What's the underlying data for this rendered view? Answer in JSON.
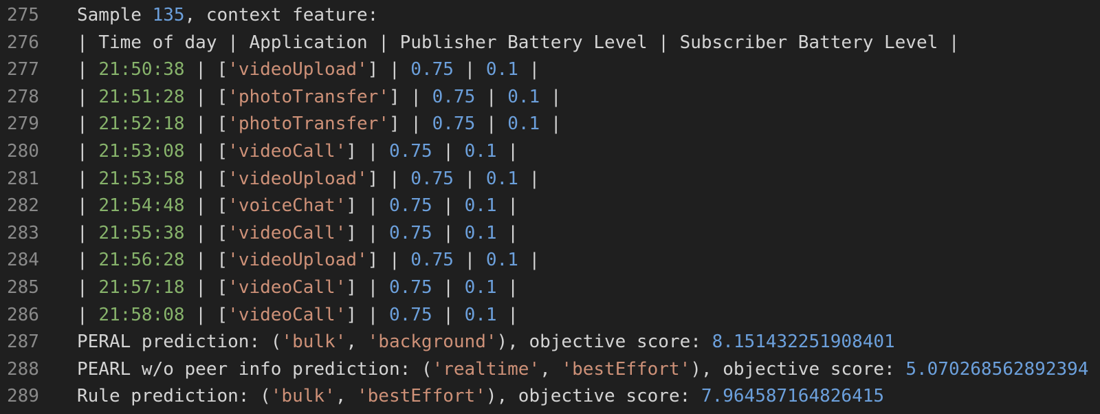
{
  "lines": [
    {
      "num": "275",
      "tokens": [
        {
          "c": "p",
          "t": "Sample "
        },
        {
          "c": "n",
          "t": "135"
        },
        {
          "c": "p",
          "t": ", context feature:"
        }
      ]
    },
    {
      "num": "276",
      "tokens": [
        {
          "c": "p",
          "t": "| Time of day | Application | Publisher Battery Level | Subscriber Battery Level |"
        }
      ]
    },
    {
      "num": "277",
      "tokens": [
        {
          "c": "p",
          "t": "| "
        },
        {
          "c": "t",
          "t": "21:50:38"
        },
        {
          "c": "p",
          "t": " | ["
        },
        {
          "c": "s",
          "t": "'videoUpload'"
        },
        {
          "c": "p",
          "t": "] | "
        },
        {
          "c": "n",
          "t": "0.75"
        },
        {
          "c": "p",
          "t": " | "
        },
        {
          "c": "n",
          "t": "0.1"
        },
        {
          "c": "p",
          "t": " |"
        }
      ]
    },
    {
      "num": "278",
      "tokens": [
        {
          "c": "p",
          "t": "| "
        },
        {
          "c": "t",
          "t": "21:51:28"
        },
        {
          "c": "p",
          "t": " | ["
        },
        {
          "c": "s",
          "t": "'photoTransfer'"
        },
        {
          "c": "p",
          "t": "] | "
        },
        {
          "c": "n",
          "t": "0.75"
        },
        {
          "c": "p",
          "t": " | "
        },
        {
          "c": "n",
          "t": "0.1"
        },
        {
          "c": "p",
          "t": " |"
        }
      ]
    },
    {
      "num": "279",
      "tokens": [
        {
          "c": "p",
          "t": "| "
        },
        {
          "c": "t",
          "t": "21:52:18"
        },
        {
          "c": "p",
          "t": " | ["
        },
        {
          "c": "s",
          "t": "'photoTransfer'"
        },
        {
          "c": "p",
          "t": "] | "
        },
        {
          "c": "n",
          "t": "0.75"
        },
        {
          "c": "p",
          "t": " | "
        },
        {
          "c": "n",
          "t": "0.1"
        },
        {
          "c": "p",
          "t": " |"
        }
      ]
    },
    {
      "num": "280",
      "tokens": [
        {
          "c": "p",
          "t": "| "
        },
        {
          "c": "t",
          "t": "21:53:08"
        },
        {
          "c": "p",
          "t": " | ["
        },
        {
          "c": "s",
          "t": "'videoCall'"
        },
        {
          "c": "p",
          "t": "] | "
        },
        {
          "c": "n",
          "t": "0.75"
        },
        {
          "c": "p",
          "t": " | "
        },
        {
          "c": "n",
          "t": "0.1"
        },
        {
          "c": "p",
          "t": " |"
        }
      ]
    },
    {
      "num": "281",
      "tokens": [
        {
          "c": "p",
          "t": "| "
        },
        {
          "c": "t",
          "t": "21:53:58"
        },
        {
          "c": "p",
          "t": " | ["
        },
        {
          "c": "s",
          "t": "'videoUpload'"
        },
        {
          "c": "p",
          "t": "] | "
        },
        {
          "c": "n",
          "t": "0.75"
        },
        {
          "c": "p",
          "t": " | "
        },
        {
          "c": "n",
          "t": "0.1"
        },
        {
          "c": "p",
          "t": " |"
        }
      ]
    },
    {
      "num": "282",
      "tokens": [
        {
          "c": "p",
          "t": "| "
        },
        {
          "c": "t",
          "t": "21:54:48"
        },
        {
          "c": "p",
          "t": " | ["
        },
        {
          "c": "s",
          "t": "'voiceChat'"
        },
        {
          "c": "p",
          "t": "] | "
        },
        {
          "c": "n",
          "t": "0.75"
        },
        {
          "c": "p",
          "t": " | "
        },
        {
          "c": "n",
          "t": "0.1"
        },
        {
          "c": "p",
          "t": " |"
        }
      ]
    },
    {
      "num": "283",
      "tokens": [
        {
          "c": "p",
          "t": "| "
        },
        {
          "c": "t",
          "t": "21:55:38"
        },
        {
          "c": "p",
          "t": " | ["
        },
        {
          "c": "s",
          "t": "'videoCall'"
        },
        {
          "c": "p",
          "t": "] | "
        },
        {
          "c": "n",
          "t": "0.75"
        },
        {
          "c": "p",
          "t": " | "
        },
        {
          "c": "n",
          "t": "0.1"
        },
        {
          "c": "p",
          "t": " |"
        }
      ]
    },
    {
      "num": "284",
      "tokens": [
        {
          "c": "p",
          "t": "| "
        },
        {
          "c": "t",
          "t": "21:56:28"
        },
        {
          "c": "p",
          "t": " | ["
        },
        {
          "c": "s",
          "t": "'videoUpload'"
        },
        {
          "c": "p",
          "t": "] | "
        },
        {
          "c": "n",
          "t": "0.75"
        },
        {
          "c": "p",
          "t": " | "
        },
        {
          "c": "n",
          "t": "0.1"
        },
        {
          "c": "p",
          "t": " |"
        }
      ]
    },
    {
      "num": "285",
      "tokens": [
        {
          "c": "p",
          "t": "| "
        },
        {
          "c": "t",
          "t": "21:57:18"
        },
        {
          "c": "p",
          "t": " | ["
        },
        {
          "c": "s",
          "t": "'videoCall'"
        },
        {
          "c": "p",
          "t": "] | "
        },
        {
          "c": "n",
          "t": "0.75"
        },
        {
          "c": "p",
          "t": " | "
        },
        {
          "c": "n",
          "t": "0.1"
        },
        {
          "c": "p",
          "t": " |"
        }
      ]
    },
    {
      "num": "286",
      "tokens": [
        {
          "c": "p",
          "t": "| "
        },
        {
          "c": "t",
          "t": "21:58:08"
        },
        {
          "c": "p",
          "t": " | ["
        },
        {
          "c": "s",
          "t": "'videoCall'"
        },
        {
          "c": "p",
          "t": "] | "
        },
        {
          "c": "n",
          "t": "0.75"
        },
        {
          "c": "p",
          "t": " | "
        },
        {
          "c": "n",
          "t": "0.1"
        },
        {
          "c": "p",
          "t": " |"
        }
      ]
    },
    {
      "num": "287",
      "tokens": [
        {
          "c": "p",
          "t": "PERAL prediction: ("
        },
        {
          "c": "s",
          "t": "'bulk'"
        },
        {
          "c": "p",
          "t": ", "
        },
        {
          "c": "s",
          "t": "'background'"
        },
        {
          "c": "p",
          "t": "), objective score: "
        },
        {
          "c": "n",
          "t": "8.151432251908401"
        }
      ]
    },
    {
      "num": "288",
      "tokens": [
        {
          "c": "p",
          "t": "PEARL w/o peer info prediction: ("
        },
        {
          "c": "s",
          "t": "'realtime'"
        },
        {
          "c": "p",
          "t": ", "
        },
        {
          "c": "s",
          "t": "'bestEffort'"
        },
        {
          "c": "p",
          "t": "), objective score: "
        },
        {
          "c": "n",
          "t": "5.070268562892394"
        }
      ]
    },
    {
      "num": "289",
      "tokens": [
        {
          "c": "p",
          "t": "Rule prediction: ("
        },
        {
          "c": "s",
          "t": "'bulk'"
        },
        {
          "c": "p",
          "t": ", "
        },
        {
          "c": "s",
          "t": "'bestEffort'"
        },
        {
          "c": "p",
          "t": "), objective score: "
        },
        {
          "c": "n",
          "t": "7.964587164826415"
        }
      ]
    }
  ]
}
